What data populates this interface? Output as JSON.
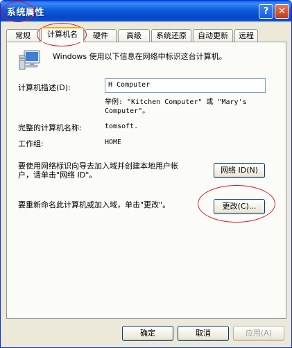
{
  "window": {
    "title": "系统属性",
    "help_label": "?",
    "close_label": "✕"
  },
  "tabs": [
    {
      "label": "常规"
    },
    {
      "label": "计算机名"
    },
    {
      "label": "硬件"
    },
    {
      "label": "高级"
    },
    {
      "label": "系统还原"
    },
    {
      "label": "自动更新"
    },
    {
      "label": "远程"
    }
  ],
  "active_tab": "计算机名",
  "panel": {
    "intro": "Windows 使用以下信息在网络中标识这台计算机。",
    "description_label": "计算机描述(D):",
    "description_value": "H Computer",
    "example_line1": "举例: \"Kitchen Computer\" 或 \"Mary's",
    "example_line2": "Computer\"。",
    "full_name_label": "完整的计算机名称:",
    "full_name_value": "tomsoft.",
    "workgroup_label": "工作组:",
    "workgroup_value": "HOME",
    "network_id_text_line1": "要使用网络标识向导去加入域并创建本地用户帐",
    "network_id_text_line2": "户，请单击\"网络 ID\"。",
    "network_id_button": "网络 ID(N)",
    "rename_text": "要重新命名此计算机或加入域，单击\"更改\"。",
    "change_button": "更改(C)..."
  },
  "footer": {
    "ok": "确定",
    "cancel": "取消",
    "apply": "应用(A)"
  },
  "colors": {
    "titlebar": "#0d5bdc",
    "dialog_bg": "#ece9d8",
    "annotation": "#e4142a",
    "active_tab_accent": "#f5a623"
  }
}
